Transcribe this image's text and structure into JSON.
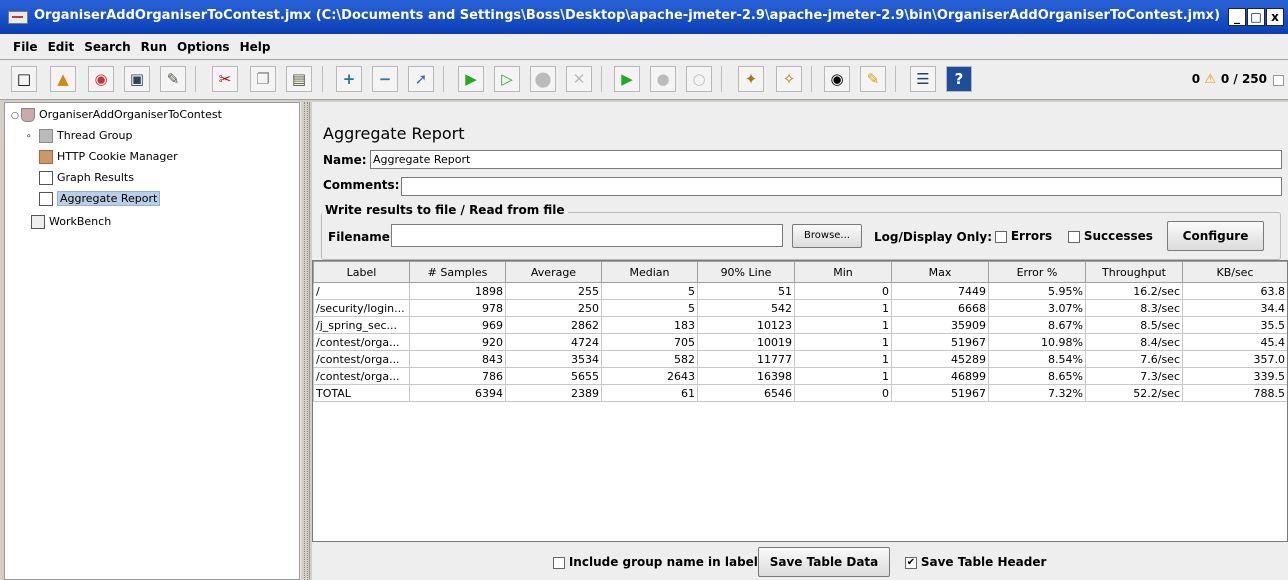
{
  "window": {
    "title": "OrganiserAddOrganiserToContest.jmx (C:\\Documents and Settings\\Boss\\Desktop\\apache-jmeter-2.9\\apache-jmeter-2.9\\bin\\OrganiserAddOrganiserToContest.jmx) - Apache ...",
    "minimize": "_",
    "maximize": "□",
    "close": "x"
  },
  "menu": [
    "File",
    "Edit",
    "Search",
    "Run",
    "Options",
    "Help"
  ],
  "toolbar": {
    "error_count": "0",
    "thread_count": "0 / 250"
  },
  "tree": {
    "root": "OrganiserAddOrganiserToContest",
    "thread_group": "Thread Group",
    "cookie_manager": "HTTP Cookie Manager",
    "graph_results": "Graph Results",
    "aggregate_report": "Aggregate Report",
    "workbench": "WorkBench"
  },
  "panel": {
    "title": "Aggregate Report",
    "name_label": "Name:",
    "name_value": "Aggregate Report",
    "comments_label": "Comments:",
    "fieldset_title": "Write results to file / Read from file",
    "filename_label": "Filename",
    "browse_label": "Browse...",
    "log_display_label": "Log/Display Only:",
    "errors_label": "Errors",
    "successes_label": "Successes",
    "configure_label": "Configure"
  },
  "table": {
    "columns": [
      "Label",
      "# Samples",
      "Average",
      "Median",
      "90% Line",
      "Min",
      "Max",
      "Error %",
      "Throughput",
      "KB/sec"
    ],
    "rows": [
      [
        "/",
        "1898",
        "255",
        "5",
        "51",
        "0",
        "7449",
        "5.95%",
        "16.2/sec",
        "63.8"
      ],
      [
        "/security/login...",
        "978",
        "250",
        "5",
        "542",
        "1",
        "6668",
        "3.07%",
        "8.3/sec",
        "34.4"
      ],
      [
        "/j_spring_sec...",
        "969",
        "2862",
        "183",
        "10123",
        "1",
        "35909",
        "8.67%",
        "8.5/sec",
        "35.5"
      ],
      [
        "/contest/orga...",
        "920",
        "4724",
        "705",
        "10019",
        "1",
        "51967",
        "10.98%",
        "8.4/sec",
        "45.4"
      ],
      [
        "/contest/orga...",
        "843",
        "3534",
        "582",
        "11777",
        "1",
        "45289",
        "8.54%",
        "7.6/sec",
        "357.0"
      ],
      [
        "/contest/orga...",
        "786",
        "5655",
        "2643",
        "16398",
        "1",
        "46899",
        "8.65%",
        "7.3/sec",
        "339.5"
      ],
      [
        "TOTAL",
        "6394",
        "2389",
        "61",
        "6546",
        "0",
        "51967",
        "7.32%",
        "52.2/sec",
        "788.5"
      ]
    ]
  },
  "bottom": {
    "include_group_label": "Include group name in label?",
    "save_table_data_label": "Save Table Data",
    "save_table_header_label": "Save Table Header",
    "save_table_header_checked": "✔"
  }
}
